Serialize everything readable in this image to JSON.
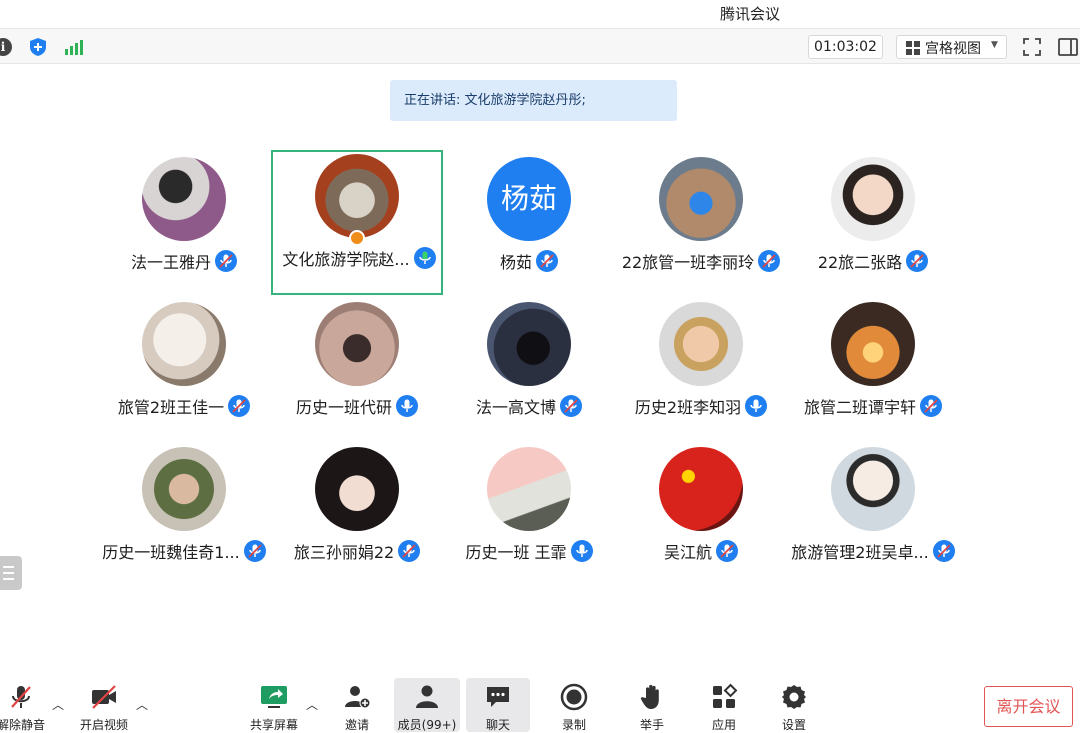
{
  "window": {
    "title": "腾讯会议"
  },
  "topbar": {
    "timer": "01:03:02",
    "view_label": "宫格视图",
    "info_glyph": "i"
  },
  "speaking": {
    "prefix": "正在讲话: ",
    "name": "文化旅游学院赵丹彤;"
  },
  "participants": [
    {
      "name": "法一王雅丹",
      "mic": "muted",
      "avatar": "photo"
    },
    {
      "name": "文化旅游学院赵...",
      "mic": "active",
      "avatar": "photo",
      "host": true,
      "speaking": true
    },
    {
      "name": "杨茹",
      "mic": "muted",
      "avatar": "text",
      "avatar_text": "杨茹"
    },
    {
      "name": "22旅管一班李丽玲",
      "mic": "muted",
      "avatar": "photo"
    },
    {
      "name": "22旅二张路",
      "mic": "muted",
      "avatar": "photo"
    },
    {
      "name": "旅管2班王佳一",
      "mic": "muted",
      "avatar": "photo"
    },
    {
      "name": "历史一班代研",
      "mic": "on",
      "avatar": "photo"
    },
    {
      "name": "法一高文博",
      "mic": "muted",
      "avatar": "photo"
    },
    {
      "name": "历史2班李知羽",
      "mic": "on",
      "avatar": "photo"
    },
    {
      "name": "旅管二班谭宇轩",
      "mic": "muted",
      "avatar": "photo"
    },
    {
      "name": "历史一班魏佳奇1...",
      "mic": "muted",
      "avatar": "photo"
    },
    {
      "name": "旅三孙丽娟22",
      "mic": "muted",
      "avatar": "photo"
    },
    {
      "name": "历史一班 王霏",
      "mic": "on",
      "avatar": "photo"
    },
    {
      "name": "吴江航",
      "mic": "muted",
      "avatar": "photo"
    },
    {
      "name": "旅游管理2班吴卓...",
      "mic": "muted",
      "avatar": "photo"
    }
  ],
  "toolbar": {
    "unmute": "解除静音",
    "video": "开启视频",
    "share": "共享屏幕",
    "invite": "邀请",
    "members": "成员(99+)",
    "chat": "聊天",
    "record": "录制",
    "raise_hand": "举手",
    "apps": "应用",
    "settings": "设置",
    "leave": "离开会议"
  },
  "colors": {
    "accent": "#1f7ff0",
    "active_border": "#37b37e",
    "leave": "#e25555",
    "share_green": "#1e9c62"
  }
}
